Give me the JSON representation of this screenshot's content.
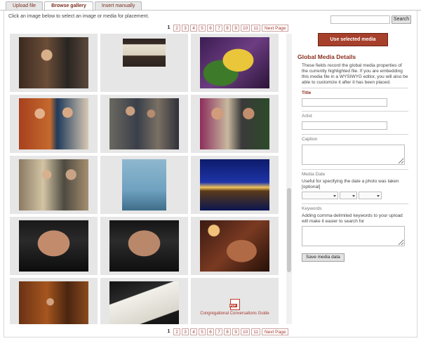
{
  "tabs": [
    "Upload file",
    "Browse gallery",
    "Insert manually"
  ],
  "instructions": "Click an image below to select an image or media for placement.",
  "search": {
    "button_label": "Search"
  },
  "pagination": {
    "current": "1",
    "pages": [
      "2",
      "3",
      "4",
      "5",
      "6",
      "7",
      "8",
      "9",
      "10",
      "11"
    ],
    "next_label": "Next Page"
  },
  "gallery": {
    "items": [
      {
        "kind": "photo",
        "shape": "land",
        "desc": "man speaking at lectern in library"
      },
      {
        "kind": "photo",
        "shape": "wide",
        "desc": "open book on dark background"
      },
      {
        "kind": "photo",
        "shape": "land",
        "desc": "etrog citron with lulav on purple cloth"
      },
      {
        "kind": "photo",
        "shape": "land",
        "desc": "two women laughing with books"
      },
      {
        "kind": "photo",
        "shape": "land",
        "desc": "group of people conversing indoors"
      },
      {
        "kind": "photo",
        "shape": "land",
        "desc": "women talking at reception"
      },
      {
        "kind": "photo",
        "shape": "land",
        "desc": "people gathered at a reception"
      },
      {
        "kind": "photo",
        "shape": "book",
        "desc": "blue book cover with dancing figure"
      },
      {
        "kind": "photo",
        "shape": "land",
        "desc": "building entrance lit at night"
      },
      {
        "kind": "photo",
        "shape": "land",
        "desc": "portrait of man with dark hair"
      },
      {
        "kind": "photo",
        "shape": "land",
        "desc": "portrait of man with dark hair"
      },
      {
        "kind": "photo",
        "shape": "land",
        "desc": "hands holding ritual objects by candlelight"
      },
      {
        "kind": "photo",
        "shape": "land",
        "desc": "speaker at lectern in wood-paneled hall"
      },
      {
        "kind": "photo",
        "shape": "land",
        "desc": "open book pages close-up"
      },
      {
        "kind": "pdf",
        "label": "Congregational Conversations Guide"
      }
    ]
  },
  "sidebar": {
    "use_button": "Use selected media",
    "title": "Global Media Details",
    "description": "These fields record the global media properties of the currently highlighted file. If you are embedding this media file in a WYSIWYG editor, you will also be able to customize it after it has been placed.",
    "fields": {
      "title_label": "Title",
      "artist_label": "Artist",
      "caption_label": "Caption",
      "media_date_label": "Media Date",
      "media_date_help": "Useful for specifying the date a photo was taken [optional]",
      "keywords_label": "Keywords",
      "keywords_help": "Adding comma-delimited keywords to your upload will make it easier to search for"
    },
    "save_button": "Save media data"
  },
  "colors": {
    "accent": "#a6402c",
    "link": "#a6382e",
    "heading": "#8a2f1f"
  }
}
